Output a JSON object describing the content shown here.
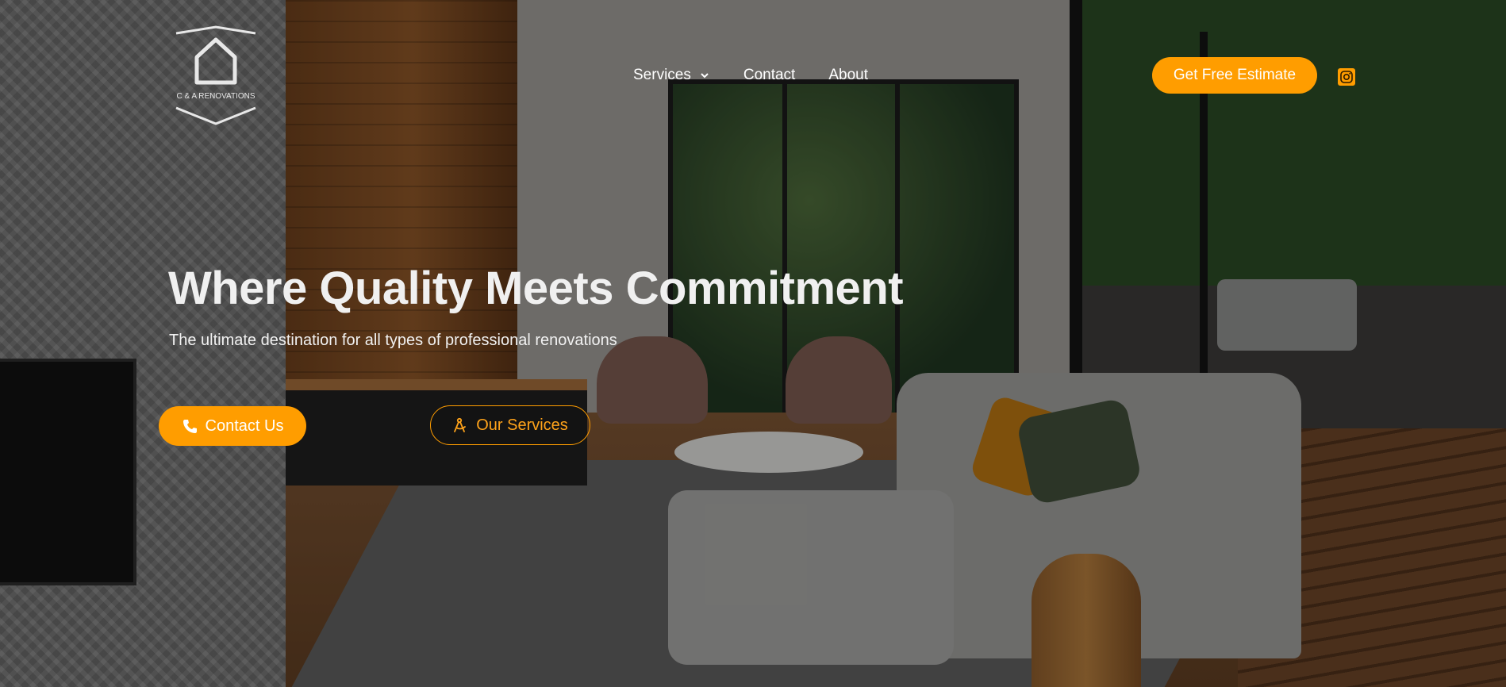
{
  "brand": {
    "name": "C & A RENOVATIONS",
    "accent_color": "#ff9d00"
  },
  "nav": {
    "items": [
      {
        "label": "Services",
        "has_dropdown": true
      },
      {
        "label": "Contact"
      },
      {
        "label": "About"
      }
    ],
    "cta_label": "Get Free Estimate",
    "social_icon": "instagram-icon"
  },
  "hero": {
    "title": "Where Quality Meets Commitment",
    "subtitle": "The ultimate destination for all types of professional renovations",
    "primary_button": {
      "label": "Contact Us",
      "icon": "phone-icon"
    },
    "secondary_button": {
      "label": "Our Services",
      "icon": "compass-icon"
    }
  }
}
